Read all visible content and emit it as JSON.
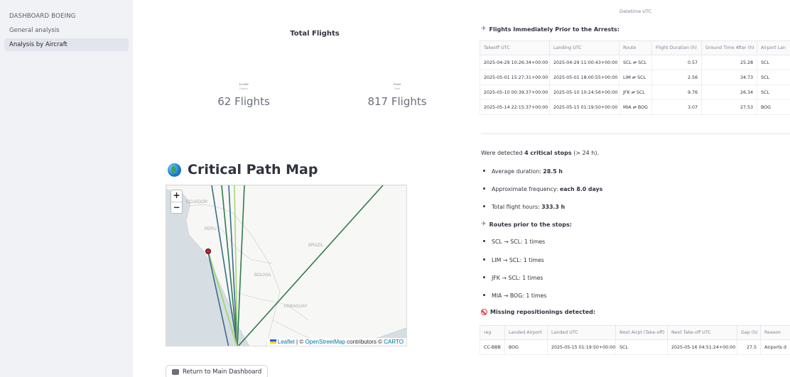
{
  "sidebar": {
    "title": "DASHBOARD BOEING",
    "items": [
      {
        "label": "General analysis",
        "active": false
      },
      {
        "label": "Analysis by Aircraft",
        "active": true
      }
    ]
  },
  "total_flights": {
    "title": "Total Flights",
    "kpis": [
      {
        "tiny_label": "12,000",
        "tiny_sub": "Flights",
        "value": "62 Flights"
      },
      {
        "tiny_label": "Fleet",
        "tiny_sub": "Total",
        "value": "817 Flights"
      }
    ]
  },
  "map_section": {
    "heading": "Critical Path Map",
    "zoom_in": "+",
    "zoom_out": "−",
    "labels": {
      "ecuador": "ECUADOR",
      "peru": "PERU",
      "brazil": "BRAZIL",
      "bolivia": "BOLIVIA",
      "paraguay": "PARAGUAY"
    },
    "attribution": {
      "leaflet": "Leaflet",
      "sep1": " | © ",
      "osm": "OpenStreetMap",
      "contributors": " contributors © ",
      "carto": "CARTO"
    },
    "colors": {
      "land": "#f7f7f5",
      "sea": "#d6dde3",
      "route_dark": "#2e7d4f",
      "route_light": "#a3d977",
      "route_blue": "#3a6b8c",
      "marker": "#c0262d"
    }
  },
  "return_button": {
    "label": "Return to Main Dashboard"
  },
  "datetime_label": "Datetime UTC",
  "prior_flights": {
    "heading": "Flights Immediately Prior to the Arrests:",
    "columns": [
      "Takeoff UTC",
      "Landing UTC",
      "Route",
      "Flight Duration (h)",
      "Ground Time After (h)",
      "Airport Lan"
    ],
    "rows": [
      [
        "2025-04-29 10:26:34+00:00",
        "2025-04-29 11:00:43+00:00",
        "SCL ⇄ SCL",
        "0.57",
        "25.28",
        "SCL"
      ],
      [
        "2025-05-01 15:27:31+00:00",
        "2025-05-01 18:00:55+00:00",
        "LIM ⇄ SCL",
        "2.56",
        "34.73",
        "SCL"
      ],
      [
        "2025-05-10 00:39:37+00:00",
        "2025-05-10 10:24:56+00:00",
        "JFK ⇄ SCL",
        "9.76",
        "26.34",
        "SCL"
      ],
      [
        "2025-05-14 22:15:37+00:00",
        "2025-05-15 01:19:50+00:00",
        "MIA ⇄ BOG",
        "3.07",
        "27.53",
        "BOG"
      ]
    ]
  },
  "critical_stops": {
    "intro_prefix": "Were detected ",
    "intro_bold": "4 critical stops",
    "intro_suffix": " (> 24 h).",
    "stats": [
      {
        "label": "Average duration: ",
        "value": "28.5 h"
      },
      {
        "label": "Approximate frequency: ",
        "value": "each 8.0 days"
      },
      {
        "label": "Total flight hours: ",
        "value": "333.3 h"
      }
    ],
    "routes_heading": "Routes prior to the stops:",
    "routes": [
      "SCL → SCL: 1 times",
      "LIM → SCL: 1 times",
      "JFK → SCL: 1 times",
      "MIA → BOG: 1 times"
    ]
  },
  "missing": {
    "heading": "Missing repositionings detected:",
    "columns": [
      "reg",
      "Landed Airport",
      "Landed UTC",
      "Next Airpt (Take-off)",
      "Next Take-off UTC",
      "Gap (h)",
      "Reason"
    ],
    "rows": [
      [
        "CC-BBB",
        "BOG",
        "2025-05-15 01:19:50+00:00",
        "SCL",
        "2025-05-16 04:51:24+00:00",
        "27.5",
        "Airports d"
      ]
    ]
  }
}
